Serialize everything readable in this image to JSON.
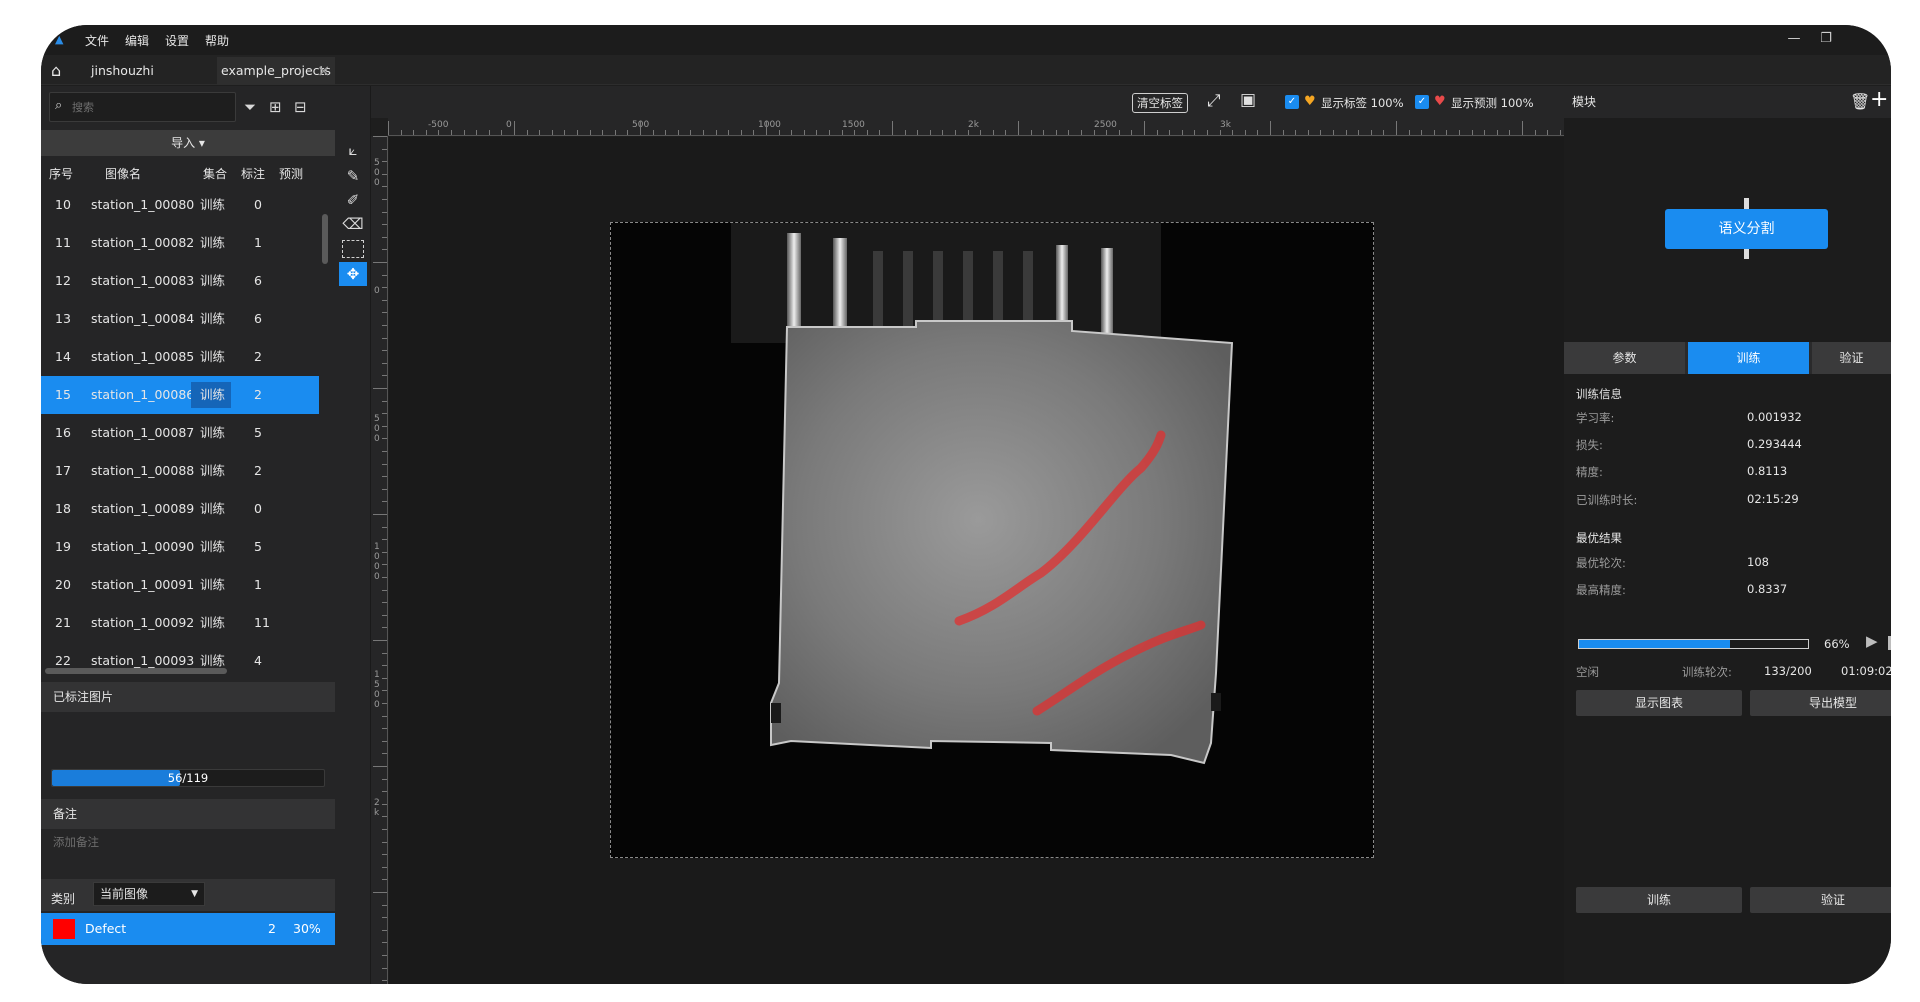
{
  "menu": {
    "file": "文件",
    "edit": "编辑",
    "settings": "设置",
    "help": "帮助"
  },
  "tabs": [
    {
      "label": "jinshouzhi"
    },
    {
      "label": "example_projects"
    }
  ],
  "left": {
    "search_placeholder": "搜索",
    "import_label": "导入 ▾",
    "columns": {
      "index": "序号",
      "name": "图像名",
      "set": "集合",
      "labels": "标注",
      "preds": "预测"
    },
    "rows": [
      {
        "idx": "10",
        "name": "station_1_00080",
        "set": "训练",
        "labels": "0"
      },
      {
        "idx": "11",
        "name": "station_1_00082",
        "set": "训练",
        "labels": "1"
      },
      {
        "idx": "12",
        "name": "station_1_00083",
        "set": "训练",
        "labels": "6"
      },
      {
        "idx": "13",
        "name": "station_1_00084",
        "set": "训练",
        "labels": "6"
      },
      {
        "idx": "14",
        "name": "station_1_00085",
        "set": "训练",
        "labels": "2"
      },
      {
        "idx": "15",
        "name": "station_1_00086",
        "set": "训练",
        "labels": "2"
      },
      {
        "idx": "16",
        "name": "station_1_00087",
        "set": "训练",
        "labels": "5"
      },
      {
        "idx": "17",
        "name": "station_1_00088",
        "set": "训练",
        "labels": "2"
      },
      {
        "idx": "18",
        "name": "station_1_00089",
        "set": "训练",
        "labels": "0"
      },
      {
        "idx": "19",
        "name": "station_1_00090",
        "set": "训练",
        "labels": "5"
      },
      {
        "idx": "20",
        "name": "station_1_00091",
        "set": "训练",
        "labels": "1"
      },
      {
        "idx": "21",
        "name": "station_1_00092",
        "set": "训练",
        "labels": "11"
      },
      {
        "idx": "22",
        "name": "station_1_00093",
        "set": "训练",
        "labels": "4"
      }
    ],
    "selected_row": "15",
    "labeled_title": "已标注图片",
    "labeled_progress": {
      "text": "56/119",
      "fraction": 0.47
    },
    "remark_title": "备注",
    "remark_placeholder": "添加备注",
    "category_label": "类别",
    "category_select": "当前图像",
    "defect": {
      "name": "Defect",
      "count": "2",
      "percent": "30%",
      "color": "#ff0000"
    }
  },
  "toolbar": {
    "clear_label": "清空标签",
    "show_labels": "显示标签 100%",
    "show_preds": "显示预测 100%",
    "label_heart_color": "#f5a623",
    "pred_heart_color": "#e84a4a"
  },
  "ruler": {
    "h_ticks": [
      "-500",
      "0",
      "500",
      "1000",
      "1500",
      "2k",
      "2500",
      "3k"
    ],
    "v_ticks": [
      "5\n0\n0",
      "0",
      "5\n0\n0",
      "1\n0\n0\n0",
      "1\n5\n0\n0",
      "2\nk"
    ]
  },
  "right": {
    "title": "模块",
    "module": "语义分割",
    "tabs": [
      "参数",
      "训练",
      "验证"
    ],
    "active_tab": "训练",
    "train_info_title": "训练信息",
    "lr_label": "学习率:",
    "lr": "0.001932",
    "loss_label": "损失:",
    "loss": "0.293444",
    "acc_label": "精度:",
    "acc": "0.8113",
    "time_label": "已训练时长:",
    "time": "02:15:29",
    "best_title": "最优结果",
    "best_epoch_label": "最优轮次:",
    "best_epoch": "108",
    "best_acc_label": "最高精度:",
    "best_acc": "0.8337",
    "progress_pct": "66%",
    "progress_fraction": 0.66,
    "status": "空闲",
    "epoch_label": "训练轮次:",
    "epoch": "133/200",
    "remaining": "01:09:02",
    "show_chart": "显示图表",
    "export_model": "导出模型",
    "train_btn": "训练",
    "validate_btn": "验证"
  }
}
